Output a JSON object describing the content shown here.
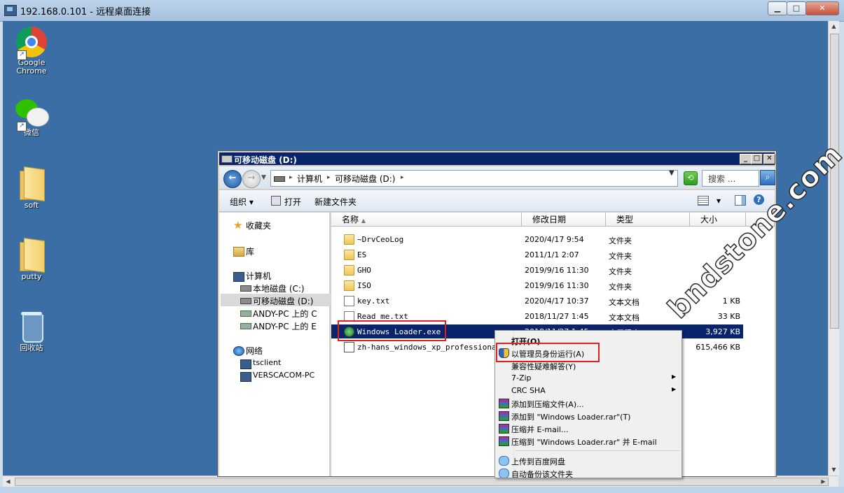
{
  "rdp": {
    "title": "192.168.0.101 - 远程桌面连接",
    "min_label": "▁",
    "max_label": "□",
    "close_label": "✕"
  },
  "desktop_icons": [
    {
      "label_line1": "Google",
      "label_line2": "Chrome",
      "icon": "chrome-icon"
    },
    {
      "label_line1": "微信",
      "label_line2": "",
      "icon": "wechat-icon"
    },
    {
      "label_line1": "soft",
      "label_line2": "",
      "icon": "folder-icon"
    },
    {
      "label_line1": "putty",
      "label_line2": "",
      "icon": "folder-icon"
    },
    {
      "label_line1": "回收站",
      "label_line2": "",
      "icon": "recycle-bin-icon"
    }
  ],
  "explorer": {
    "title": "可移动磁盘 (D:)",
    "address": {
      "segments": [
        "计算机",
        "可移动磁盘 (D:)"
      ]
    },
    "search_placeholder": "搜索 ...",
    "toolbar": {
      "organize": "组织",
      "open": "打开",
      "new_folder": "新建文件夹"
    },
    "nav": {
      "favorites": "收藏夹",
      "libraries": "库",
      "computer": "计算机",
      "local_disk": "本地磁盘 (C:)",
      "removable": "可移动磁盘 (D:)",
      "andy_c": "ANDY-PC 上的 C",
      "andy_e": "ANDY-PC 上的 E",
      "network": "网络",
      "tsclient": "tsclient",
      "versacom": "VERSCACOM-PC"
    },
    "columns": {
      "name": "名称",
      "date": "修改日期",
      "type": "类型",
      "size": "大小"
    },
    "files": [
      {
        "name": "~DrvCeoLog",
        "date": "2020/4/17 9:54",
        "type": "文件夹",
        "size": "",
        "icon": "folder"
      },
      {
        "name": "ES",
        "date": "2011/1/1 2:07",
        "type": "文件夹",
        "size": "",
        "icon": "folder"
      },
      {
        "name": "GHO",
        "date": "2019/9/16 11:30",
        "type": "文件夹",
        "size": "",
        "icon": "folder"
      },
      {
        "name": "ISO",
        "date": "2019/9/16 11:30",
        "type": "文件夹",
        "size": "",
        "icon": "folder"
      },
      {
        "name": "key.txt",
        "date": "2020/4/17 10:37",
        "type": "文本文档",
        "size": "1 KB",
        "icon": "txt"
      },
      {
        "name": "Read me.txt",
        "date": "2018/11/27 1:45",
        "type": "文本文档",
        "size": "33 KB",
        "icon": "txt"
      },
      {
        "name": "Windows Loader.exe",
        "date": "2018/11/27 1:45",
        "type": "应用程序",
        "size": "3,927 KB",
        "icon": "exe",
        "selected": true
      },
      {
        "name": "zh-hans_windows_xp_professional_w",
        "date": "",
        "type": "",
        "size": "615,466 KB",
        "icon": "iso"
      }
    ]
  },
  "context_menu": {
    "items": [
      {
        "label": "打开(O)",
        "bold": true,
        "icon": "",
        "submenu": false
      },
      {
        "label": "以管理员身份运行(A)",
        "bold": false,
        "icon": "shield",
        "submenu": false
      },
      {
        "label": "兼容性疑难解答(Y)",
        "bold": false,
        "icon": "",
        "submenu": false
      },
      {
        "label": "7-Zip",
        "bold": false,
        "icon": "",
        "submenu": true
      },
      {
        "label": "CRC SHA",
        "bold": false,
        "icon": "",
        "submenu": true
      },
      {
        "label": "添加到压缩文件(A)...",
        "bold": false,
        "icon": "rar",
        "submenu": false
      },
      {
        "label": "添加到 \"Windows Loader.rar\"(T)",
        "bold": false,
        "icon": "rar",
        "submenu": false
      },
      {
        "label": "压缩并 E-mail...",
        "bold": false,
        "icon": "rar",
        "submenu": false
      },
      {
        "label": "压缩到 \"Windows Loader.rar\" 并 E-mail",
        "bold": false,
        "icon": "rar",
        "submenu": false
      },
      {
        "label": "上传到百度网盘",
        "bold": false,
        "icon": "cloud",
        "submenu": false
      },
      {
        "label": "自动备份该文件夹",
        "bold": false,
        "icon": "cloud",
        "submenu": false
      }
    ]
  },
  "watermark": "bndstone.com",
  "colors": {
    "desktop": "#3a6ea5",
    "selection": "#0a246a",
    "highlight_box": "#e02020"
  }
}
